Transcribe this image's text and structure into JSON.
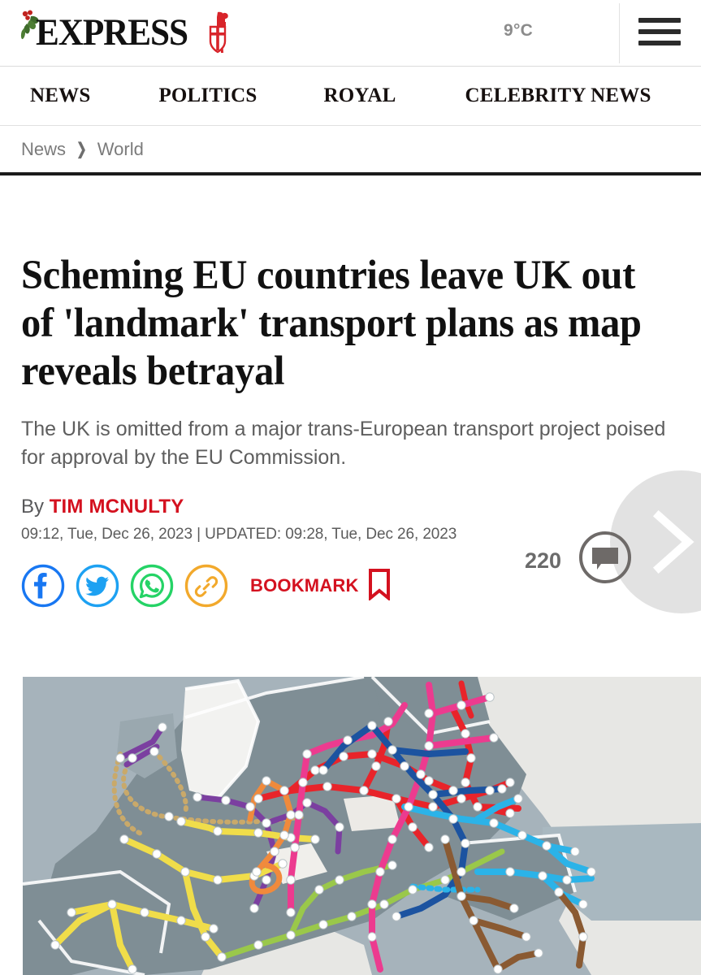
{
  "site": {
    "brand": "EXPRESS",
    "logo_holly_icon": "holly-sprig-icon",
    "logo_knight_icon": "crusader-knight-shield-icon",
    "temperature": "9°C",
    "menu_icon": "hamburger-menu-icon"
  },
  "nav": {
    "items": [
      {
        "label": "NEWS"
      },
      {
        "label": "POLITICS"
      },
      {
        "label": "ROYAL"
      },
      {
        "label": "CELEBRITY NEWS"
      }
    ]
  },
  "breadcrumb": {
    "items": [
      {
        "label": "News"
      },
      {
        "label": "World"
      }
    ],
    "separator": "❯",
    "separator_icon": "chevron-right-icon"
  },
  "article": {
    "headline": "Scheming EU countries leave UK out of 'landmark' transport plans as map reveals betrayal",
    "standfirst": "The UK is omitted from a major trans-European transport project poised for approval by the EU Commission.",
    "by_prefix": "By ",
    "author": "TIM MCNULTY",
    "timestamp": "09:12, Tue, Dec 26, 2023 | UPDATED: 09:28, Tue, Dec 26, 2023"
  },
  "share": {
    "icons": [
      {
        "name": "facebook-share-icon",
        "color": "#1877F2"
      },
      {
        "name": "twitter-share-icon",
        "color": "#1DA1F2"
      },
      {
        "name": "whatsapp-share-icon",
        "color": "#25D366"
      },
      {
        "name": "copy-link-icon",
        "color": "#F2A92C"
      }
    ],
    "bookmark_label": "BOOKMARK",
    "bookmark_icon": "bookmark-ribbon-icon",
    "bookmark_color": "#D4111F"
  },
  "comments": {
    "count": "220",
    "icon": "comment-bubble-icon"
  },
  "carousel": {
    "next_icon": "chevron-right-icon"
  },
  "map": {
    "alt_name": "trans-european-transport-network-corridor-map",
    "sea_color": "#a6b3bb",
    "land_color": "#7f8e95",
    "excluded_land_color": "#e8e8e6",
    "corridor_colors": {
      "red": "#e8242a",
      "magenta": "#ec3b8f",
      "blue": "#1c53a0",
      "cyan": "#2bb3e8",
      "purple": "#7b3fa0",
      "orange": "#f08a3c",
      "yellow": "#f0dd4a",
      "green": "#9ac84a",
      "brown": "#8a5a32",
      "dotted_tan": "#c9a96a"
    }
  }
}
